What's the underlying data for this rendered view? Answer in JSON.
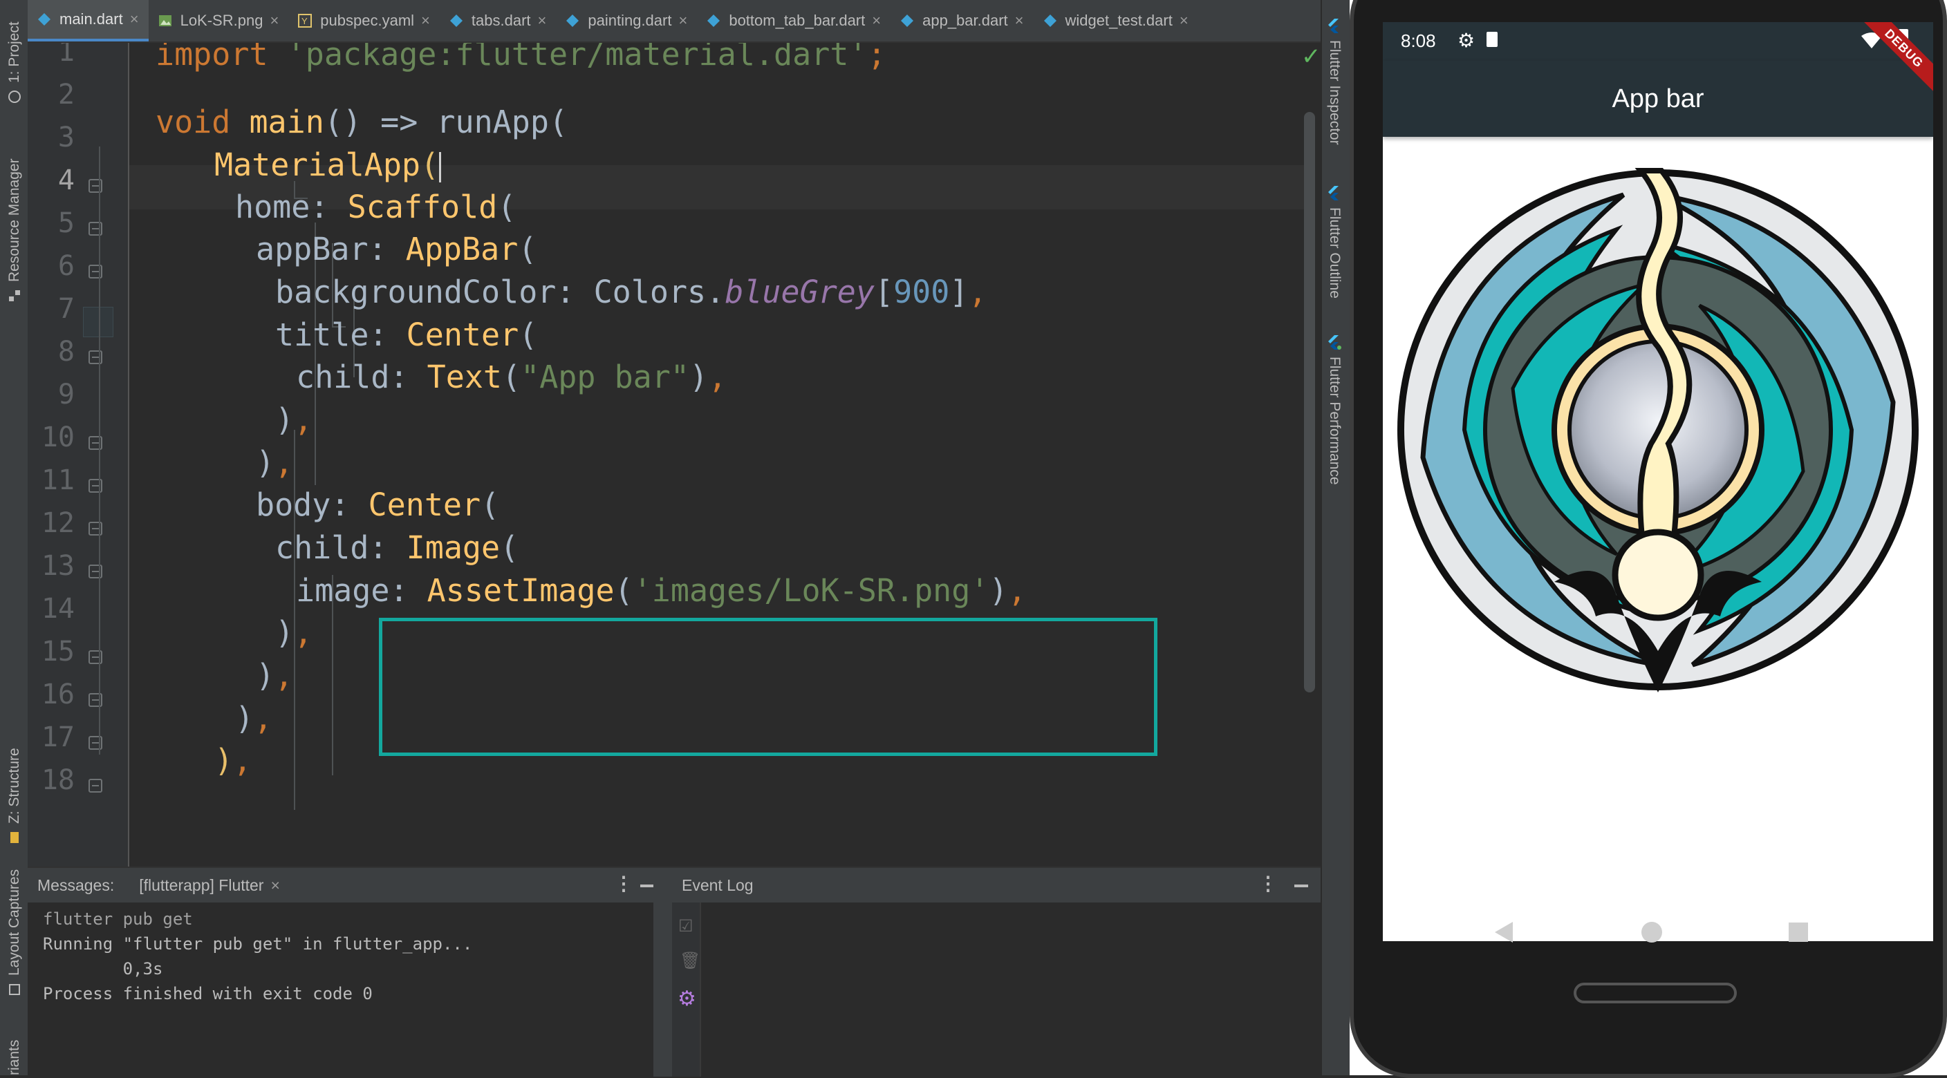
{
  "left_tools": {
    "project": "1: Project",
    "resource_manager": "Resource Manager",
    "structure": "Z: Structure",
    "layout_captures": "Layout Captures",
    "variants": "riants"
  },
  "tabs": [
    {
      "label": "main.dart",
      "icon": "dart-icon",
      "active": true
    },
    {
      "label": "LoK-SR.png",
      "icon": "image-icon",
      "active": false
    },
    {
      "label": "pubspec.yaml",
      "icon": "yaml-icon",
      "active": false
    },
    {
      "label": "tabs.dart",
      "icon": "dart-icon",
      "active": false
    },
    {
      "label": "painting.dart",
      "icon": "dart-icon",
      "active": false
    },
    {
      "label": "bottom_tab_bar.dart",
      "icon": "dart-icon",
      "active": false
    },
    {
      "label": "app_bar.dart",
      "icon": "dart-icon",
      "active": false
    },
    {
      "label": "widget_test.dart",
      "icon": "dart-icon",
      "active": false
    }
  ],
  "tab_close_glyph": "×",
  "editor": {
    "line_numbers": [
      "1",
      "2",
      "3",
      "4",
      "5",
      "6",
      "7",
      "8",
      "9",
      "10",
      "11",
      "12",
      "13",
      "14",
      "15",
      "16",
      "17",
      "18"
    ],
    "current_line": "4",
    "code": {
      "l1_import": "import",
      "l1_str": "'package:flutter/material.dart'",
      "l1_end": ";",
      "l3_void": "void",
      "l3_main": "main",
      "l3_mid": "() => ",
      "l3_run": "runApp",
      "l3_end": "(",
      "l4_cls": "MaterialApp",
      "l4_paren": "(",
      "l5_key": "home: ",
      "l5_cls": "Scaffold",
      "l5_end": "(",
      "l6_key": "appBar: ",
      "l6_cls": "AppBar",
      "l6_end": "(",
      "l7_key": "backgroundColor: ",
      "l7_colors": "Colors.",
      "l7_field": "blueGrey",
      "l7_br1": "[",
      "l7_num": "900",
      "l7_br2": "]",
      "l7_comma": ",",
      "l8_key": "title: ",
      "l8_cls": "Center",
      "l8_end": "(",
      "l9_key": "child: ",
      "l9_cls": "Text",
      "l9_open": "(",
      "l9_str": "\"App bar\"",
      "l9_close": ")",
      "l9_comma": ",",
      "l10_close": ")",
      "l10_comma": ",",
      "l11_close": ")",
      "l11_comma": ",",
      "l12_key": "body: ",
      "l12_cls": "Center",
      "l12_end": "(",
      "l13_key": "child: ",
      "l13_cls": "Image",
      "l13_end": "(",
      "l14_key": "image: ",
      "l14_cls": "AssetImage",
      "l14_open": "(",
      "l14_str": "'images/LoK-SR.png'",
      "l14_close": ")",
      "l14_comma": ",",
      "l15_close": ")",
      "l15_comma": ",",
      "l16_close": ")",
      "l16_comma": ",",
      "l17_close": ")",
      "l17_comma": ",",
      "l18_close": ")",
      "l18_comma": ","
    }
  },
  "right_tools": {
    "inspector": "Flutter Inspector",
    "outline": "Flutter Outline",
    "performance": "Flutter Performance"
  },
  "messages": {
    "label": "Messages:",
    "tab": "[flutterapp] Flutter",
    "lines": [
      "flutter pub get",
      "Running \"flutter pub get\" in flutter_app...",
      "        0,3s",
      "Process finished with exit code 0"
    ]
  },
  "event_log": {
    "title": "Event Log"
  },
  "phone": {
    "time": "8:08",
    "app_bar_title": "App bar",
    "debug_banner": "DEBUG",
    "appbar_color": "#263238",
    "image_asset": "images/LoK-SR.png"
  }
}
